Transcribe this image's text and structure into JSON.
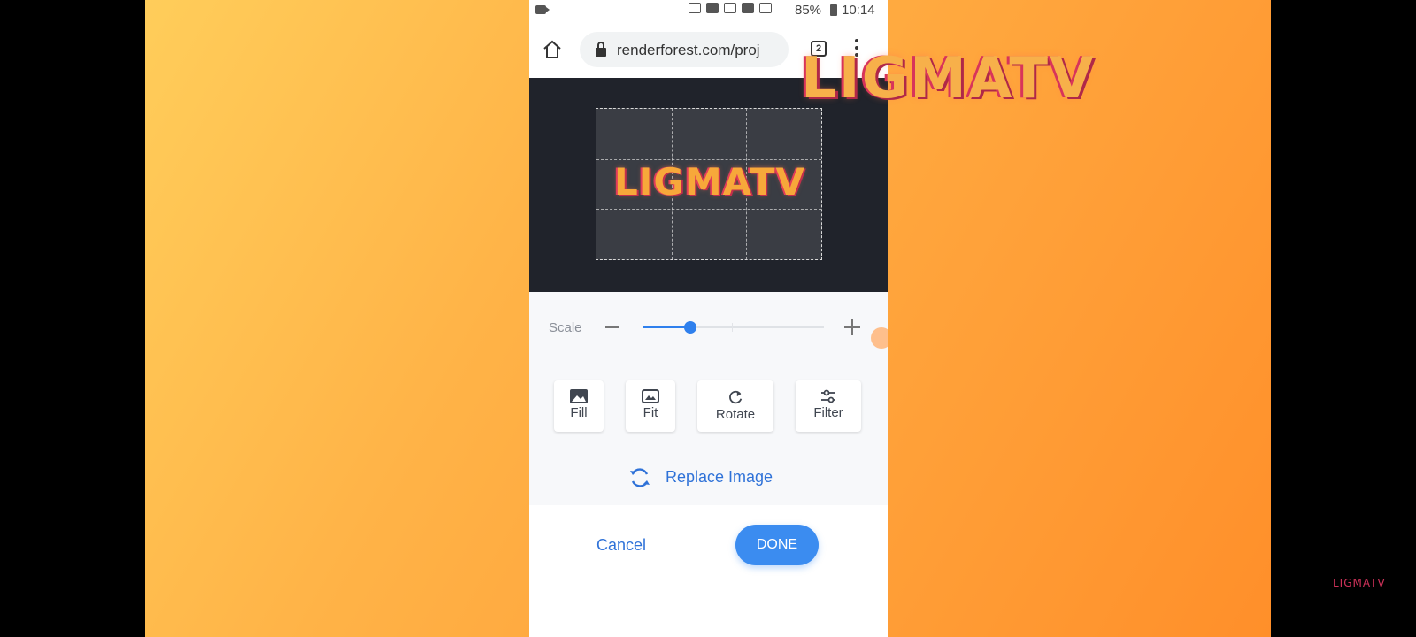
{
  "statusbar": {
    "battery": "85%",
    "time": "10:14"
  },
  "browser": {
    "url": "renderforest.com/proj",
    "tab_count": "2"
  },
  "preview": {
    "logo_text": "LIGMATV"
  },
  "scale": {
    "label": "Scale",
    "value_fraction": 0.26
  },
  "tools": [
    {
      "label": "Fill",
      "icon": "image-fill-icon"
    },
    {
      "label": "Fit",
      "icon": "image-fit-icon"
    },
    {
      "label": "Rotate",
      "icon": "rotate-icon"
    },
    {
      "label": "Filter",
      "icon": "sliders-icon"
    }
  ],
  "replace": {
    "label": "Replace Image",
    "icon": "refresh-icon"
  },
  "actions": {
    "cancel": "Cancel",
    "done": "DONE"
  },
  "watermark": {
    "large": "LIGMATV",
    "corner": "LIGMATV"
  },
  "colors": {
    "accent": "#3b8cf0",
    "link": "#2f72d8",
    "background_orange": "#ffa23a",
    "preview_bg": "#20232b"
  }
}
